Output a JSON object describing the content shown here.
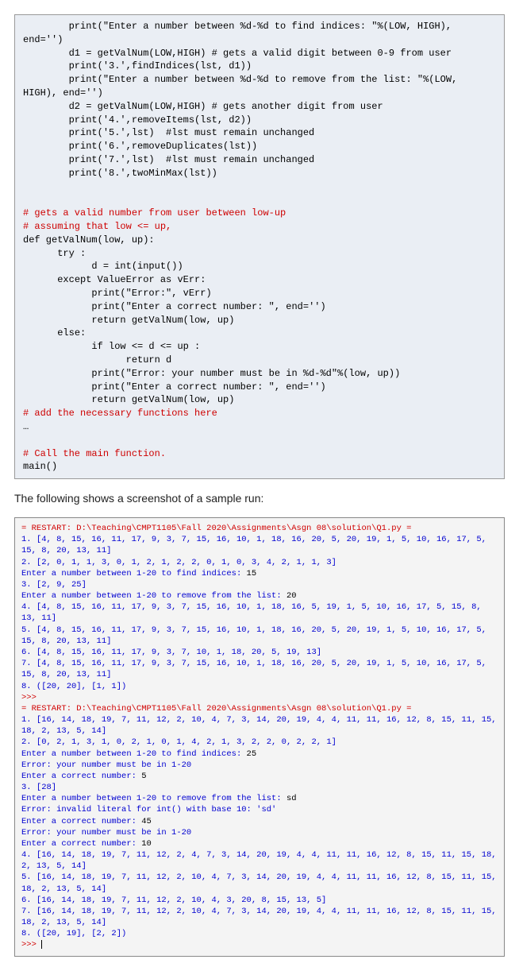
{
  "code": {
    "line01": "        print(\"Enter a number between %d-%d to find indices: \"%(LOW, HIGH), end='')",
    "line02": "        d1 = getValNum(LOW,HIGH) # gets a valid digit between 0-9 from user",
    "line03": "        print('3.',findIndices(lst, d1))",
    "line04": "        print(\"Enter a number between %d-%d to remove from the list: \"%(LOW, HIGH), end='')",
    "line05": "        d2 = getValNum(LOW,HIGH) # gets another digit from user",
    "line06": "        print('4.',removeItems(lst, d2))",
    "line07": "        print('5.',lst)  #lst must remain unchanged",
    "line08": "        print('6.',removeDuplicates(lst))",
    "line09": "        print('7.',lst)  #lst must remain unchanged",
    "line10": "        print('8.',twoMinMax(lst))",
    "line11": "",
    "line12": "",
    "line13c": "# gets a valid number from user between low-up",
    "line14c": "# assuming that low <= up,",
    "line15": "def getValNum(low, up):",
    "line16": "      try :",
    "line17": "            d = int(input())",
    "line18": "      except ValueError as vErr:",
    "line19": "            print(\"Error:\", vErr)",
    "line20": "            print(\"Enter a correct number: \", end='')",
    "line21": "            return getValNum(low, up)",
    "line22": "      else:",
    "line23": "            if low <= d <= up :",
    "line24": "                  return d",
    "line25": "            print(\"Error: your number must be in %d-%d\"%(low, up))",
    "line26": "            print(\"Enter a correct number: \", end='')",
    "line27": "            return getValNum(low, up)",
    "line28c": "# add the necessary functions here",
    "line29": "…",
    "line30": "",
    "line31c": "# Call the main function.",
    "line32": "main()"
  },
  "caption": "The following shows a screenshot of a sample run:",
  "console": {
    "run1_header_a": "= RESTART: D:\\Teaching\\CMPT1105\\Fall 2020\\Assignments\\Asgn 08\\solution\\Q1.py =",
    "run1_l1": "1. [4, 8, 15, 16, 11, 17, 9, 3, 7, 15, 16, 10, 1, 18, 16, 20, 5, 20, 19, 1, 5, 10, 16, 17, 5, 15, 8, 20, 13, 11]",
    "run1_l2": "2. [2, 0, 1, 1, 3, 0, 1, 2, 1, 2, 2, 0, 1, 0, 3, 4, 2, 1, 1, 3]",
    "run1_prompt1": "Enter a number between 1-20 to find indices: ",
    "run1_input1": "15",
    "run1_l3": "3. [2, 9, 25]",
    "run1_prompt2": "Enter a number between 1-20 to remove from the list: ",
    "run1_input2": "20",
    "run1_l4": "4. [4, 8, 15, 16, 11, 17, 9, 3, 7, 15, 16, 10, 1, 18, 16, 5, 19, 1, 5, 10, 16, 17, 5, 15, 8, 13, 11]",
    "run1_l5": "5. [4, 8, 15, 16, 11, 17, 9, 3, 7, 15, 16, 10, 1, 18, 16, 20, 5, 20, 19, 1, 5, 10, 16, 17, 5, 15, 8, 20, 13, 11]",
    "run1_l6": "6. [4, 8, 15, 16, 11, 17, 9, 3, 7, 10, 1, 18, 20, 5, 19, 13]",
    "run1_l7": "7. [4, 8, 15, 16, 11, 17, 9, 3, 7, 15, 16, 10, 1, 18, 16, 20, 5, 20, 19, 1, 5, 10, 16, 17, 5, 15, 8, 20, 13, 11]",
    "run1_l8": "8. ([20, 20], [1, 1])",
    "prompt1": ">>> ",
    "run2_header_a": "= RESTART: D:\\Teaching\\CMPT1105\\Fall 2020\\Assignments\\Asgn 08\\solution\\Q1.py =",
    "run2_l1": "1. [16, 14, 18, 19, 7, 11, 12, 2, 10, 4, 7, 3, 14, 20, 19, 4, 4, 11, 11, 16, 12, 8, 15, 11, 15, 18, 2, 13, 5, 14]",
    "run2_l2": "2. [0, 2, 1, 3, 1, 0, 2, 1, 0, 1, 4, 2, 1, 3, 2, 2, 0, 2, 2, 1]",
    "run2_prompt1": "Enter a number between 1-20 to find indices: ",
    "run2_input1": "25",
    "run2_err1": "Error: your number must be in 1-20",
    "run2_prompt2": "Enter a correct number: ",
    "run2_input2": "5",
    "run2_l3": "3. [28]",
    "run2_prompt3": "Enter a number between 1-20 to remove from the list: ",
    "run2_input3": "sd",
    "run2_err2": "Error: invalid literal for int() with base 10: 'sd'",
    "run2_prompt4": "Enter a correct number: ",
    "run2_input4": "45",
    "run2_err3": "Error: your number must be in 1-20",
    "run2_prompt5": "Enter a correct number: ",
    "run2_input5": "10",
    "run2_l4": "4. [16, 14, 18, 19, 7, 11, 12, 2, 4, 7, 3, 14, 20, 19, 4, 4, 11, 11, 16, 12, 8, 15, 11, 15, 18, 2, 13, 5, 14]",
    "run2_l5": "5. [16, 14, 18, 19, 7, 11, 12, 2, 10, 4, 7, 3, 14, 20, 19, 4, 4, 11, 11, 16, 12, 8, 15, 11, 15, 18, 2, 13, 5, 14]",
    "run2_l6": "6. [16, 14, 18, 19, 7, 11, 12, 2, 10, 4, 3, 20, 8, 15, 13, 5]",
    "run2_l7": "7. [16, 14, 18, 19, 7, 11, 12, 2, 10, 4, 7, 3, 14, 20, 19, 4, 4, 11, 11, 16, 12, 8, 15, 11, 15, 18, 2, 13, 5, 14]",
    "run2_l8": "8. ([20, 19], [2, 2])",
    "prompt2": ">>> "
  }
}
